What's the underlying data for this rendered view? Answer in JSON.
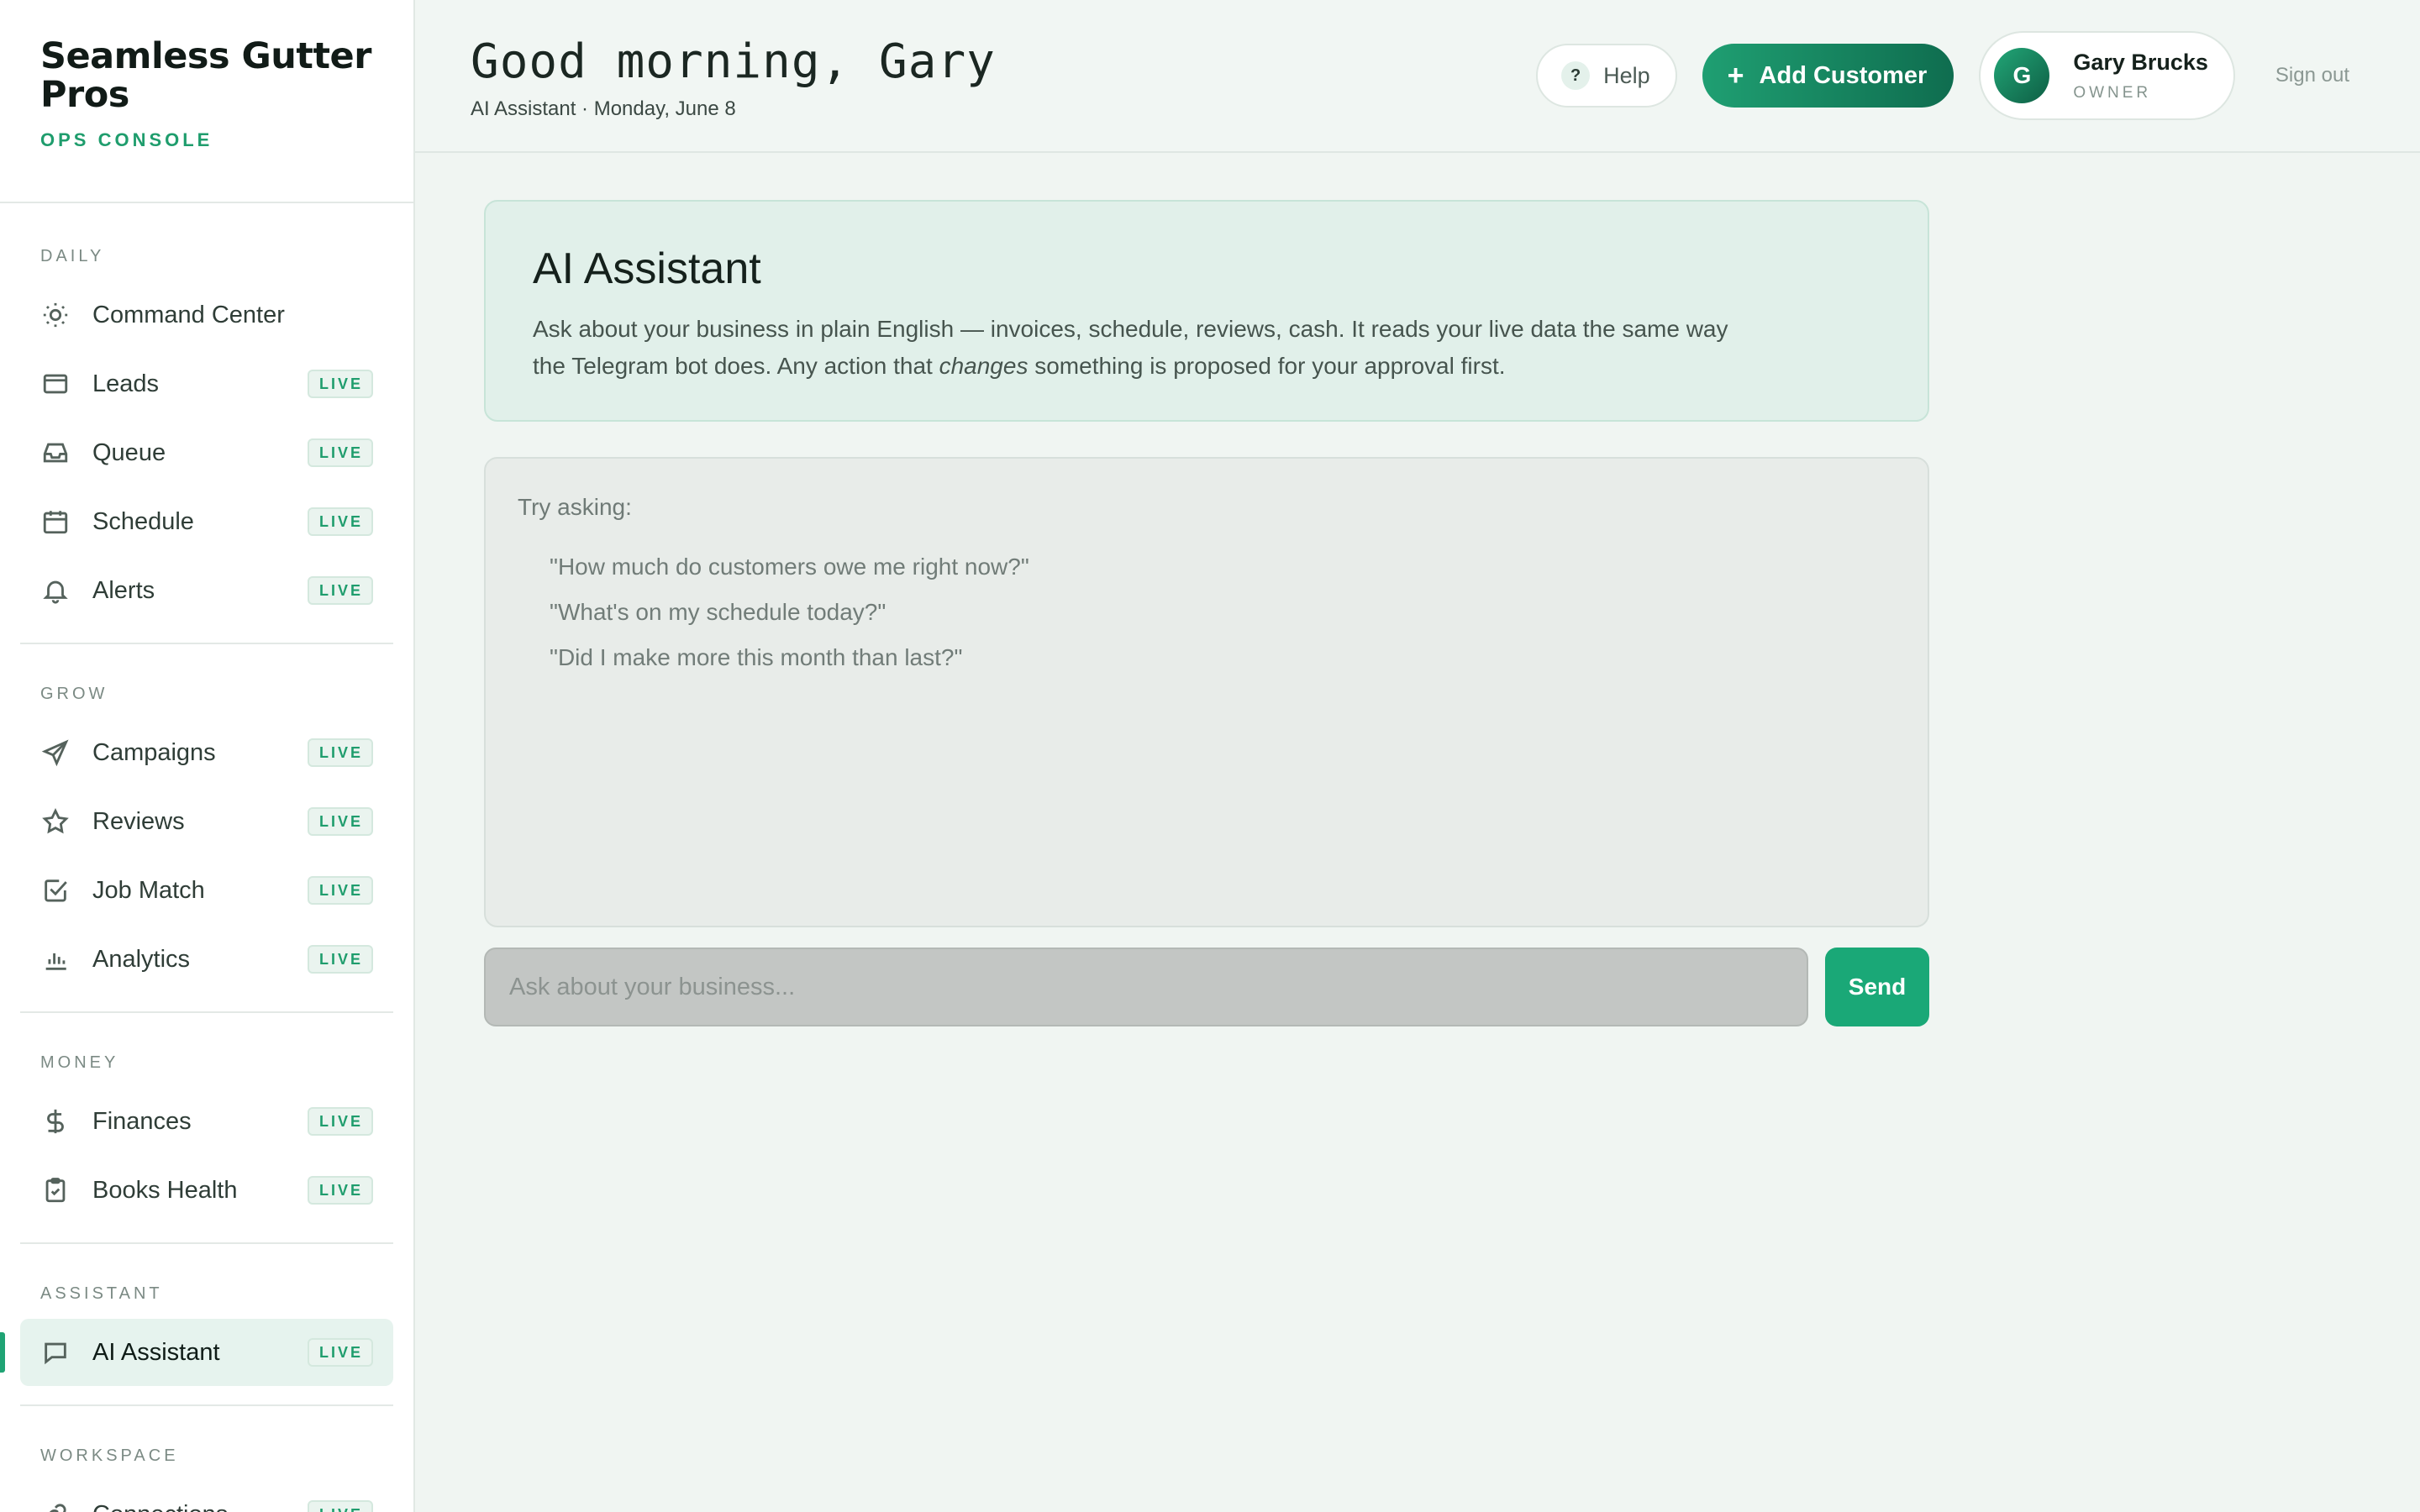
{
  "brand": {
    "name": "Seamless Gutter Pros",
    "subtitle": "OPS CONSOLE"
  },
  "nav": {
    "sections": [
      {
        "title": "DAILY",
        "items": [
          {
            "label": "Command Center",
            "icon": "sun-icon",
            "badge": ""
          },
          {
            "label": "Leads",
            "icon": "mail-icon",
            "badge": "LIVE"
          },
          {
            "label": "Queue",
            "icon": "inbox-icon",
            "badge": "LIVE"
          },
          {
            "label": "Schedule",
            "icon": "calendar-icon",
            "badge": "LIVE"
          },
          {
            "label": "Alerts",
            "icon": "bell-icon",
            "badge": "LIVE"
          }
        ]
      },
      {
        "title": "GROW",
        "items": [
          {
            "label": "Campaigns",
            "icon": "send-icon",
            "badge": "LIVE"
          },
          {
            "label": "Reviews",
            "icon": "star-icon",
            "badge": "LIVE"
          },
          {
            "label": "Job Match",
            "icon": "check-square-icon",
            "badge": "LIVE"
          },
          {
            "label": "Analytics",
            "icon": "bar-chart-icon",
            "badge": "LIVE"
          }
        ]
      },
      {
        "title": "MONEY",
        "items": [
          {
            "label": "Finances",
            "icon": "dollar-icon",
            "badge": "LIVE"
          },
          {
            "label": "Books Health",
            "icon": "clipboard-icon",
            "badge": "LIVE"
          }
        ]
      },
      {
        "title": "ASSISTANT",
        "items": [
          {
            "label": "AI Assistant",
            "icon": "chat-icon",
            "badge": "LIVE",
            "active": true
          }
        ]
      },
      {
        "title": "WORKSPACE",
        "items": [
          {
            "label": "Connections",
            "icon": "link-icon",
            "badge": "LIVE"
          }
        ]
      }
    ]
  },
  "header": {
    "greeting": "Good morning, Gary",
    "subline": "AI Assistant · Monday, June 8",
    "help_label": "Help",
    "help_glyph": "?",
    "add_customer_label": "Add Customer",
    "add_customer_glyph": "+",
    "user": {
      "initial": "G",
      "name": "Gary Brucks",
      "role": "OWNER"
    },
    "signout_label": "Sign out"
  },
  "assistant": {
    "title": "AI Assistant",
    "description_before": "Ask about your business in plain English — invoices, schedule, reviews, cash. It reads your live data the same way the Telegram bot does. Any action that ",
    "description_emphasis": "changes",
    "description_after": " something is proposed for your approval first.",
    "try_label": "Try asking:",
    "suggestions": [
      "\"How much do customers owe me right now?\"",
      "\"What's on my schedule today?\"",
      "\"Did I make more this month than last?\""
    ],
    "input_placeholder": "Ask about your business...",
    "input_value": "",
    "send_label": "Send"
  },
  "colors": {
    "accent": "#1f9d6d",
    "accent_dark": "#0f6d4f",
    "background": "#f0f5f2",
    "sidebar": "#ffffff"
  }
}
